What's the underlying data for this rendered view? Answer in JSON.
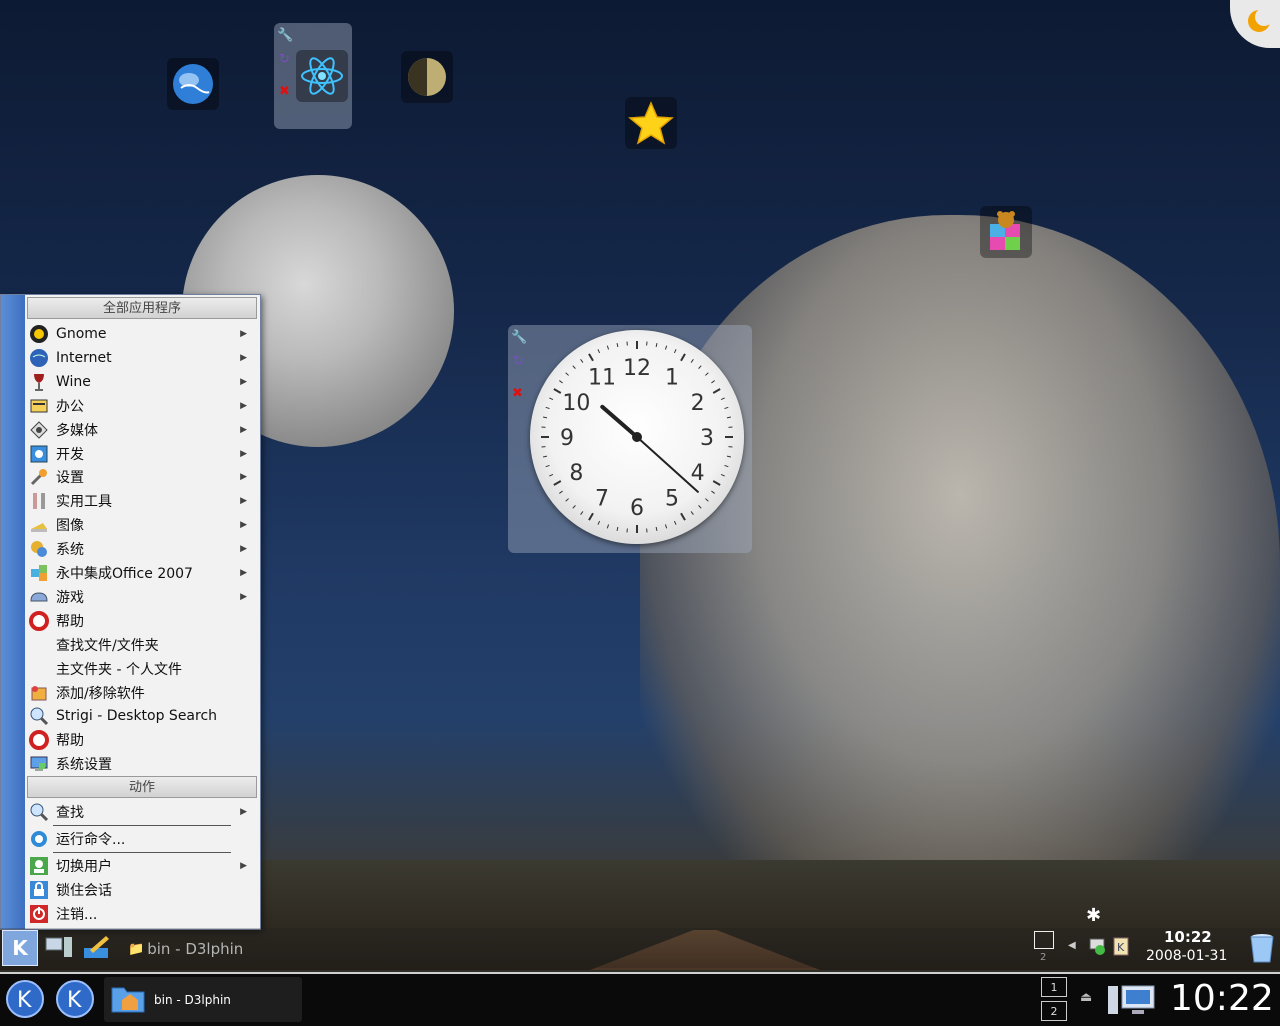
{
  "menu": {
    "header_apps": "全部应用程序",
    "header_actions": "动作",
    "items": [
      {
        "label": "Gnome",
        "icon": "gnome-icon",
        "submenu": true
      },
      {
        "label": "Internet",
        "icon": "globe-icon",
        "submenu": true
      },
      {
        "label": "Wine",
        "icon": "wine-glass-icon",
        "submenu": true
      },
      {
        "label": "办公",
        "icon": "office-icon",
        "submenu": true
      },
      {
        "label": "多媒体",
        "icon": "multimedia-icon",
        "submenu": true
      },
      {
        "label": "开发",
        "icon": "development-icon",
        "submenu": true
      },
      {
        "label": "设置",
        "icon": "wrench-icon",
        "submenu": true
      },
      {
        "label": "实用工具",
        "icon": "utilities-icon",
        "submenu": true
      },
      {
        "label": "图像",
        "icon": "graphics-icon",
        "submenu": true
      },
      {
        "label": "系统",
        "icon": "system-icon",
        "submenu": true
      },
      {
        "label": "永中集成Office 2007",
        "icon": "eio-office-icon",
        "submenu": true
      },
      {
        "label": "游戏",
        "icon": "games-icon",
        "submenu": true
      },
      {
        "label": "帮助",
        "icon": "lifebuoy-icon",
        "submenu": false
      },
      {
        "label": "查找文件/文件夹",
        "icon": "",
        "submenu": false
      },
      {
        "label": "主文件夹 - 个人文件",
        "icon": "",
        "submenu": false
      },
      {
        "label": "添加/移除软件",
        "icon": "add-remove-software-icon",
        "submenu": false
      },
      {
        "label": "Strigi - Desktop Search",
        "icon": "search-icon",
        "submenu": false
      },
      {
        "label": "帮助",
        "icon": "lifebuoy-icon",
        "submenu": false
      },
      {
        "label": "系统设置",
        "icon": "system-settings-icon",
        "submenu": false
      }
    ],
    "actions": [
      {
        "label": "查找",
        "icon": "search-icon",
        "submenu": true
      },
      {
        "label": "运行命令...",
        "icon": "run-command-icon",
        "submenu": false
      },
      {
        "label": "切换用户",
        "icon": "switch-user-icon",
        "submenu": true
      },
      {
        "label": "锁住会话",
        "icon": "lock-icon",
        "submenu": false
      },
      {
        "label": "注销...",
        "icon": "logout-icon",
        "submenu": false
      }
    ]
  },
  "clock_widget": {
    "numbers": [
      "12",
      "1",
      "2",
      "3",
      "4",
      "5",
      "6",
      "7",
      "8",
      "9",
      "10",
      "11"
    ],
    "hour": 10,
    "minute": 22
  },
  "panel_top": {
    "window_label": "bin - D3lphin",
    "time": "10:22",
    "date": "2008-01-31"
  },
  "panel_bottom": {
    "task_label": "bin - D3lphin",
    "pager": [
      "1",
      "2"
    ],
    "time": "10:22"
  },
  "colors": {
    "menu_side": "#4a7dcc",
    "accent": "#3e6fc0"
  }
}
